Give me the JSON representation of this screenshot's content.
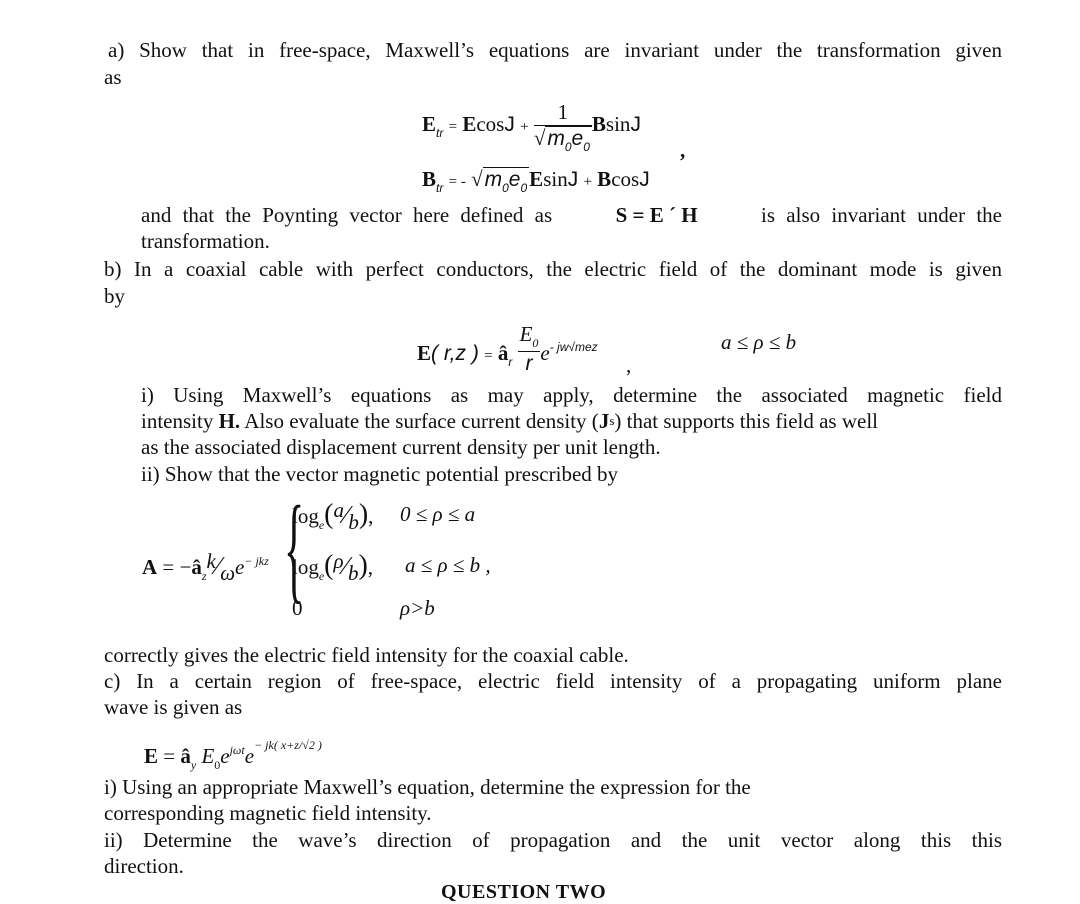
{
  "part_a": {
    "line1": "a) Show that in free-space, Maxwell’s equations are invariant under the transformation given",
    "line2": "as",
    "eq1": {
      "lhs": "E",
      "lhs_sub": "tr",
      "equals": "=",
      "term1": "E",
      "term1_fn": "cos",
      "angle": "J",
      "plus": "+",
      "frac_num": "1",
      "frac_den_sqrt": "m",
      "frac_den_sub1": "0",
      "frac_den_e": "e",
      "frac_den_sub2": "0",
      "term2": "B",
      "term2_fn": "sin",
      "comma": ","
    },
    "eq2": {
      "lhs": "B",
      "lhs_sub": "tr",
      "equals": "= -",
      "sqrt_m": "m",
      "sqrt_sub1": "0",
      "sqrt_e": "e",
      "sqrt_sub2": "0",
      "term1": "E",
      "term1_fn": "sin",
      "angle": "J",
      "plus": "+",
      "term2": "B",
      "term2_fn": "cos"
    },
    "line3_pre": "and that the Poynting vector here defined as",
    "poynting": "S = E ´ H",
    "line3_post": "is also invariant under the",
    "line4": "transformation."
  },
  "part_b": {
    "line1": "b) In a coaxial cable with perfect conductors, the electric field of the dominant mode is given",
    "line2": "by",
    "eq": {
      "lhs": "E",
      "args": "( r,z )",
      "equals": "=",
      "unit": "â",
      "unit_sub": "r",
      "num": "E",
      "num_sub": "0",
      "den": "r",
      "exp_base": "e",
      "exponent": "- jw√mez",
      "comma": ",",
      "range": "a ≤ ρ ≤ b"
    },
    "i_line1": "i) Using Maxwell’s equations as may apply, determine the associated magnetic field",
    "i_line2_pre": "intensity",
    "i_line2_H": "H.",
    "i_line2_mid": " Also evaluate the surface current density (",
    "i_line2_J": "J",
    "i_line2_Jsub": "s",
    "i_line2_post": ") that supports this field as well",
    "i_line3": "as the associated displacement current density per unit length.",
    "ii_line1": "ii) Show that the vector magnetic potential prescribed by",
    "A_eq": {
      "lhs": "A",
      "equals": "= −",
      "unit": "â",
      "unit_sub": "z",
      "k": "k",
      "omega": "ω",
      "exp": "e",
      "exp_sup": "− jkz",
      "cases": [
        {
          "expr_fn": "log",
          "expr_sub": "e",
          "num": "a",
          "den": "b",
          "cond": "0 ≤ ρ ≤ a",
          "sep": ","
        },
        {
          "expr_fn": "log",
          "expr_sub": "e",
          "num": "ρ",
          "den": "b",
          "cond": "a ≤ ρ ≤ b ,",
          "sep": ","
        },
        {
          "expr": "0",
          "cond": "ρ>b"
        }
      ]
    },
    "ii_line2": "correctly gives the electric field intensity for the coaxial cable."
  },
  "part_c": {
    "line1": "c) In a certain region of free-space, electric field intensity of a propagating uniform plane",
    "line2": "wave is given as",
    "eq": {
      "lhs": "E",
      "equals": "=",
      "unit": "â",
      "unit_sub": "y",
      "amp": "E",
      "amp_sub": "0",
      "e1": "e",
      "e1_sup": "jωt",
      "e2": "e",
      "e2_sup": "− jk( x+z/√2 )"
    },
    "i_line1": "i) Using an appropriate Maxwell’s equation, determine the expression for the",
    "i_line2": "corresponding magnetic field intensity.",
    "ii_line1": "ii) Determine the wave’s direction of propagation and the unit vector along this this",
    "ii_line2": "direction."
  },
  "next_heading": "QUESTION TWO"
}
